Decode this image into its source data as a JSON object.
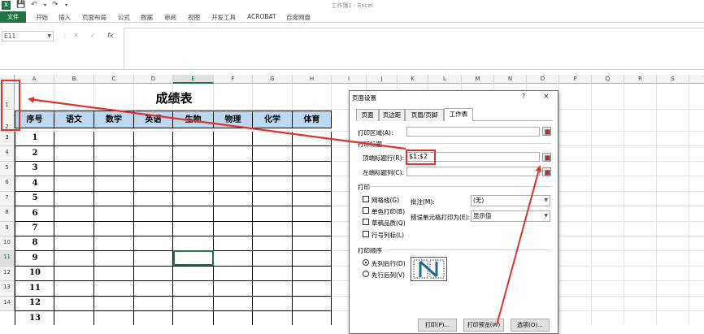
{
  "app": {
    "title": "工作簿1 - Excel",
    "logo": "X"
  },
  "ribbon": {
    "file": "文件",
    "tabs": [
      "开始",
      "插入",
      "页面布局",
      "公式",
      "数据",
      "审阅",
      "视图",
      "开发工具",
      "ACROBAT",
      "百度网盘"
    ]
  },
  "formula": {
    "namebox": "E11",
    "fx": "fx"
  },
  "columns": [
    "A",
    "B",
    "C",
    "D",
    "E",
    "F",
    "G",
    "H",
    "I",
    "J",
    "K",
    "L",
    "M",
    "N",
    "O",
    "P",
    "Q",
    "R",
    "S",
    "T"
  ],
  "rows": [
    "1",
    "2",
    "3",
    "4",
    "5",
    "6",
    "7",
    "8",
    "9",
    "10",
    "11",
    "12",
    "13",
    "14"
  ],
  "sheet": {
    "title": "成绩表",
    "headers": [
      "序号",
      "语文",
      "数学",
      "英语",
      "生物",
      "物理",
      "化学",
      "体育"
    ],
    "seq": [
      "1",
      "2",
      "3",
      "4",
      "5",
      "6",
      "7",
      "8",
      "9",
      "10",
      "11",
      "12",
      "13"
    ]
  },
  "dialog": {
    "title": "页面设置",
    "help": "?",
    "close": "×",
    "tabs": [
      "页面",
      "页边距",
      "页眉/页脚",
      "工作表"
    ],
    "print_area_label": "打印区域(A):",
    "print_titles_label": "打印标题",
    "top_rows_label": "顶端标题行(R):",
    "top_rows_value": "$1:$2",
    "left_cols_label": "左端标题列(C):",
    "print_label": "打印",
    "gridlines": "网格线(G)",
    "mono": "单色打印(B)",
    "draft": "草稿品质(Q)",
    "rowcol": "行号列标(L)",
    "comments_label": "批注(M):",
    "comments_value": "(无)",
    "errors_label": "错误单元格打印为(E):",
    "errors_value": "显示值",
    "order_label": "打印顺序",
    "down_over": "先列后行(D)",
    "over_down": "先行后列(V)",
    "btn_print": "打印(P)...",
    "btn_preview": "打印预览(W)",
    "btn_options": "选项(O)..."
  },
  "colors": {
    "accent": "#217346",
    "header_fill": "#bdd7ee",
    "annotation": "#e0312c"
  }
}
